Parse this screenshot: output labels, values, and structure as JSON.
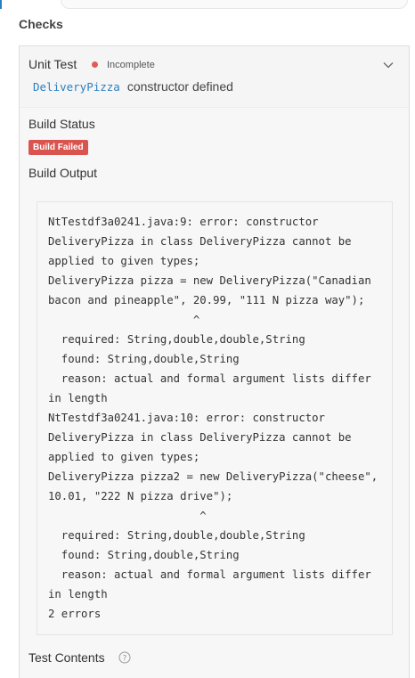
{
  "section": {
    "title": "Checks"
  },
  "check": {
    "type": "Unit Test",
    "status": "Incomplete",
    "colors": {
      "status_dot": "#e05a5a",
      "code_accent": "#2a7fc1"
    },
    "description_code": "DeliveryPizza",
    "description_text": "constructor defined"
  },
  "build": {
    "status_heading": "Build Status",
    "badge": "Build Failed",
    "badge_color": "#d9534f",
    "output_heading": "Build Output",
    "output_lines": [
      "NtTestdf3a0241.java:9: error: constructor",
      "DeliveryPizza in class DeliveryPizza cannot be",
      "applied to given types;",
      "DeliveryPizza pizza = new DeliveryPizza(\"Canadian",
      "bacon and pineapple\", 20.99, \"111 N pizza way\");",
      "                      ^",
      "  required: String,double,double,String",
      "  found: String,double,String",
      "  reason: actual and formal argument lists differ",
      "in length",
      "NtTestdf3a0241.java:10: error: constructor",
      "DeliveryPizza in class DeliveryPizza cannot be",
      "applied to given types;",
      "DeliveryPizza pizza2 = new DeliveryPizza(\"cheese\",",
      "10.01, \"222 N pizza drive\");",
      "                       ^",
      "  required: String,double,double,String",
      "  found: String,double,String",
      "  reason: actual and formal argument lists differ",
      "in length",
      "2 errors"
    ]
  },
  "test_contents": {
    "heading": "Test Contents",
    "help_icon": "question-circle-icon"
  },
  "icons": {
    "collapse": "chevron-down-icon"
  }
}
